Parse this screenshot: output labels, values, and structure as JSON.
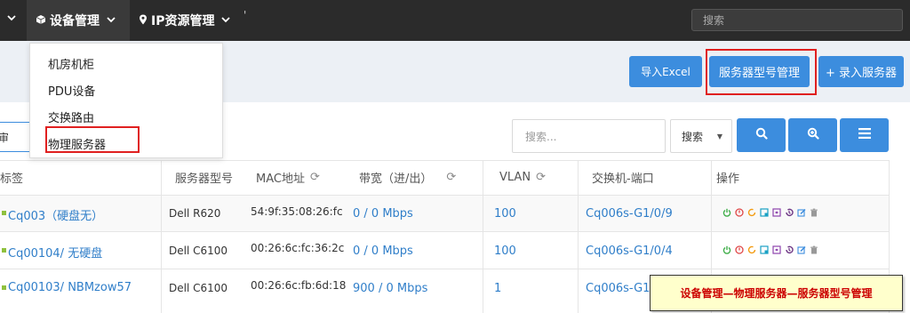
{
  "navbar": {
    "items": [
      {
        "label": "设备管理",
        "icon": "cube-icon"
      },
      {
        "label": "IP资源管理",
        "icon": "map-marker-icon"
      }
    ],
    "tick": "'",
    "search_placeholder": "搜索"
  },
  "dropdown": {
    "items": [
      "机房机柜",
      "PDU设备",
      "交换路由",
      "物理服务器"
    ]
  },
  "actions": {
    "import_excel": "导入Excel",
    "server_model_mgmt": "服务器型号管理",
    "add_server": "+ 录入服务器"
  },
  "toolbar": {
    "left_filter_value": "审",
    "search_placeholder": "搜索...",
    "search_select": "搜索"
  },
  "table": {
    "headers": [
      "标签",
      "服务器型号",
      "MAC地址",
      "带宽（进/出）",
      "VLAN",
      "交换机-端口",
      "操作"
    ],
    "rows": [
      {
        "label": "Cq003（硬盘无）",
        "model": "Dell R620",
        "mac": "54:9f:35:08:26:fc",
        "bandwidth": "0 / 0 Mbps",
        "vlan": "100",
        "switch_port": "Cq006s-G1/0/9"
      },
      {
        "label": "Cq00104/ 无硬盘",
        "model": "Dell C6100",
        "mac": "00:26:6c:fc:36:2c",
        "bandwidth": "0 / 0 Mbps",
        "vlan": "100",
        "switch_port": "Cq006s-G1/0/4"
      },
      {
        "label": "Cq00103/ NBMzow57",
        "model": "Dell C6100",
        "mac": "00:26:6c:fb:6d:18",
        "bandwidth": "900 / 0 Mbps",
        "vlan": "1",
        "switch_port": "Cq006s-G1/"
      }
    ]
  },
  "annotation": "设备管理—物理服务器—服务器型号管理",
  "colors": {
    "navbar_bg": "#2b2b2b",
    "primary": "#3c8dde",
    "link": "#2f7ec9",
    "highlight_red": "#e02020",
    "annotation_bg": "#ffffcc"
  }
}
